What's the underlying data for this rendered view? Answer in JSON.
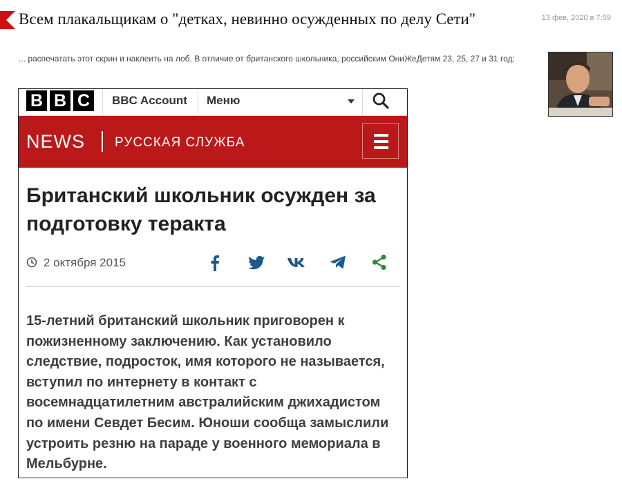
{
  "post": {
    "title": "Всем плакальщикам о \"детках, невинно осужденных по делу Сети\"",
    "date": "13 фев, 2020 в 7:59",
    "intro": "... распечатать этот скрин и наклеить на лоб. В отличие от британского школьника, российским ОниЖеДетям 23, 25, 27 и 31 год:",
    "accent_color": "#cc1111"
  },
  "bbc": {
    "logo_letters": [
      "B",
      "B",
      "C"
    ],
    "account_label": "BBC Account",
    "menu_label": "Меню",
    "news_label": "NEWS",
    "service_label": "РУССКАЯ СЛУЖБА",
    "brand_color": "#bb1919",
    "headline": "Британский школьник осужден за подготовку теракта",
    "article_date": "2 октября 2015",
    "share_icons": [
      "facebook-icon",
      "twitter-icon",
      "vk-icon",
      "telegram-icon",
      "share-icon"
    ],
    "share_color": "#1c5a8c",
    "share_green": "#2b8a3e",
    "lead_text": "15-летний британский школьник приговорен к пожизненному заключению. Как установило следствие, подросток, имя которого не называется, вступил по интернету в контакт с восемнадцатилетним австралийским джихадистом по имени Севдет Бесим. Юноши сообща замыслили устроить резню на параде у военного мемориала в Мельбурне."
  }
}
